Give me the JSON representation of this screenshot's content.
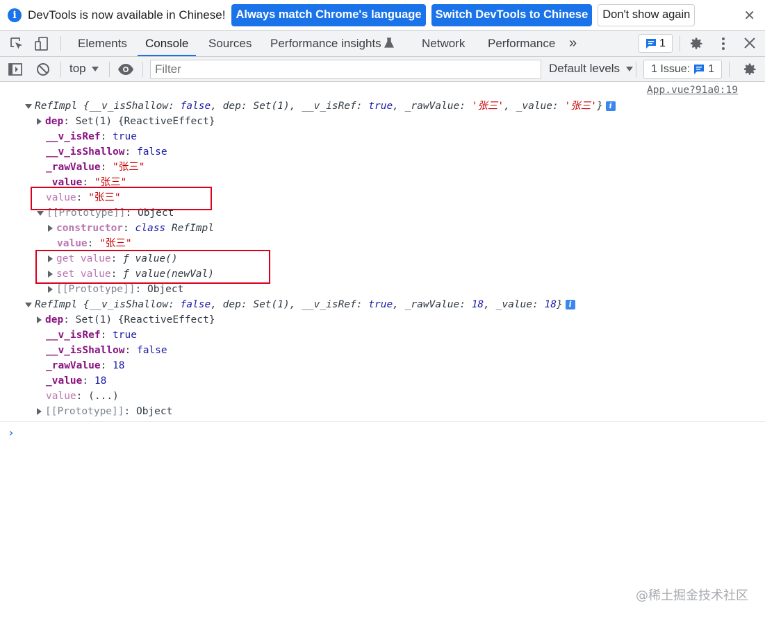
{
  "infobar": {
    "message": "DevTools is now available in Chinese!",
    "btn_match": "Always match Chrome's language",
    "btn_switch": "Switch DevTools to Chinese",
    "btn_dismiss": "Don't show again",
    "close": "✕"
  },
  "tabs": {
    "elements": "Elements",
    "console": "Console",
    "sources": "Sources",
    "perf_insights": "Performance insights",
    "network": "Network",
    "performance": "Performance",
    "more": "»",
    "issue_count": "1"
  },
  "toolbar": {
    "context": "top",
    "filter_placeholder": "Filter",
    "levels": "Default levels",
    "issues_label": "1 Issue:",
    "issues_count": "1"
  },
  "console": {
    "source": "App.vue?91a0:19",
    "obj1": {
      "summary_name": "RefImpl",
      "summary_open": " {",
      "s_k1": "__v_isShallow",
      "s_v1": "false",
      "s_k2": "dep",
      "s_v2": "Set(1)",
      "s_k3": "__v_isRef",
      "s_v3": "true",
      "s_k4": "_rawValue",
      "s_v4": "'张三'",
      "s_k5": "_value",
      "s_v5": "'张三'",
      "dep_key": "dep",
      "dep_val": "Set(1) {ReactiveEffect}",
      "isref_key": "__v_isRef",
      "isref_val": "true",
      "isshallow_key": "__v_isShallow",
      "isshallow_val": "false",
      "raw_key": "_rawValue",
      "raw_val": "\"张三\"",
      "value_key": "_value",
      "value_val": "\"张三\"",
      "getter_key": "value",
      "getter_val": "\"张三\"",
      "proto_key": "[[Prototype]]",
      "proto_val": "Object",
      "ctor_key": "constructor",
      "ctor_kw": "class",
      "ctor_name": "RefImpl",
      "pvalue_key": "value",
      "pvalue_val": "\"张三\"",
      "get_key": "get value",
      "get_val": "ƒ value()",
      "set_key": "set value",
      "set_val": "ƒ value(newVal)",
      "proto2_key": "[[Prototype]]",
      "proto2_val": "Object"
    },
    "obj2": {
      "summary_name": "RefImpl",
      "s_k1": "__v_isShallow",
      "s_v1": "false",
      "s_k2": "dep",
      "s_v2": "Set(1)",
      "s_k3": "__v_isRef",
      "s_v3": "true",
      "s_k4": "_rawValue",
      "s_v4": "18",
      "s_k5": "_value",
      "s_v5": "18",
      "dep_key": "dep",
      "dep_val": "Set(1) {ReactiveEffect}",
      "isref_key": "__v_isRef",
      "isref_val": "true",
      "isshallow_key": "__v_isShallow",
      "isshallow_val": "false",
      "raw_key": "_rawValue",
      "raw_val": "18",
      "value_key": "_value",
      "value_val": "18",
      "getter_key": "value",
      "getter_val": "(...)",
      "proto_key": "[[Prototype]]",
      "proto_val": "Object"
    },
    "prompt": "›"
  },
  "watermark": "@稀土掘金技术社区",
  "colors": {
    "accent": "#1a73e8",
    "highlight_box": "#d9001b"
  }
}
